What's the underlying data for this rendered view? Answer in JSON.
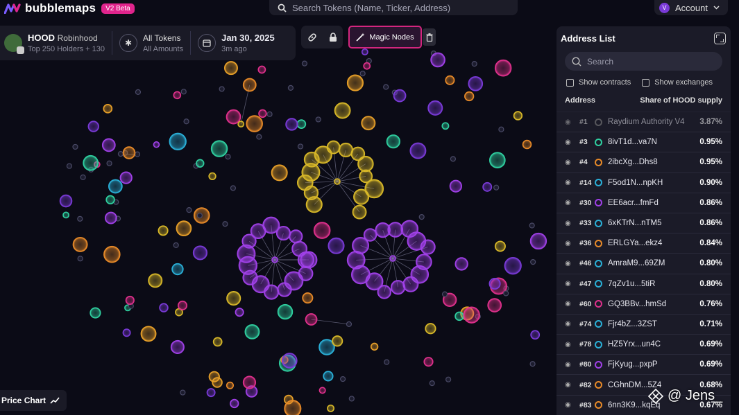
{
  "brand": {
    "name": "bubblemaps",
    "badge": "V2 Beta"
  },
  "search_top": {
    "placeholder": "Search Tokens (Name, Ticker, Address)"
  },
  "account": {
    "initial": "V",
    "label": "Account"
  },
  "token": {
    "ticker": "HOOD",
    "name": "Robinhood",
    "holders": "Top 250 Holders + 130"
  },
  "amount_filter": {
    "label": "All Tokens",
    "sub": "All Amounts"
  },
  "date": {
    "label": "Jan 30, 2025",
    "sub": "3m ago"
  },
  "magic_nodes": {
    "label": "Magic Nodes"
  },
  "address_list": {
    "title": "Address List",
    "search_placeholder": "Search",
    "show_contracts": "Show contracts",
    "show_exchanges": "Show exchanges",
    "col_address": "Address",
    "col_share": "Share of HOOD supply",
    "rows": [
      {
        "rank": "#1",
        "name": "Raydium Authority V4",
        "pct": "3.87%",
        "color": "#888888",
        "dim": true
      },
      {
        "rank": "#3",
        "name": "8ivT1d...va7N",
        "pct": "0.95%",
        "color": "#2fd0a0"
      },
      {
        "rank": "#4",
        "name": "2ibcXg...Dhs8",
        "pct": "0.95%",
        "color": "#e88a28"
      },
      {
        "rank": "#14",
        "name": "F5od1N...npKH",
        "pct": "0.90%",
        "color": "#2ab0d8"
      },
      {
        "rank": "#30",
        "name": "EE6acr...fmFd",
        "pct": "0.86%",
        "color": "#a040e8"
      },
      {
        "rank": "#33",
        "name": "6xKTrN...nTM5",
        "pct": "0.86%",
        "color": "#2ab0d8"
      },
      {
        "rank": "#36",
        "name": "ERLGYa...ekz4",
        "pct": "0.84%",
        "color": "#e88a28"
      },
      {
        "rank": "#46",
        "name": "AmraM9...69ZM",
        "pct": "0.80%",
        "color": "#2ab0d8"
      },
      {
        "rank": "#47",
        "name": "7qZv1u...5tiR",
        "pct": "0.80%",
        "color": "#2ab0d8"
      },
      {
        "rank": "#60",
        "name": "GQ3BBv...hmSd",
        "pct": "0.76%",
        "color": "#e0308c"
      },
      {
        "rank": "#74",
        "name": "Fjr4bZ...3ZST",
        "pct": "0.71%",
        "color": "#2ab0d8"
      },
      {
        "rank": "#78",
        "name": "HZ5Yrx...un4C",
        "pct": "0.69%",
        "color": "#2ab0d8"
      },
      {
        "rank": "#80",
        "name": "FjKyug...pxpP",
        "pct": "0.69%",
        "color": "#a040e8"
      },
      {
        "rank": "#82",
        "name": "CGhnDM...5Z4",
        "pct": "0.68%",
        "color": "#e88a28"
      },
      {
        "rank": "#83",
        "name": "6nn3K9...kqEq",
        "pct": "0.67%",
        "color": "#e88a28"
      }
    ]
  },
  "price_chart": {
    "label": "Price Chart"
  },
  "watermark": {
    "text": "@ Jens_"
  },
  "colors": {
    "accent": "#e0248c",
    "panel": "#1a1a26",
    "background": "#0b0b16"
  }
}
